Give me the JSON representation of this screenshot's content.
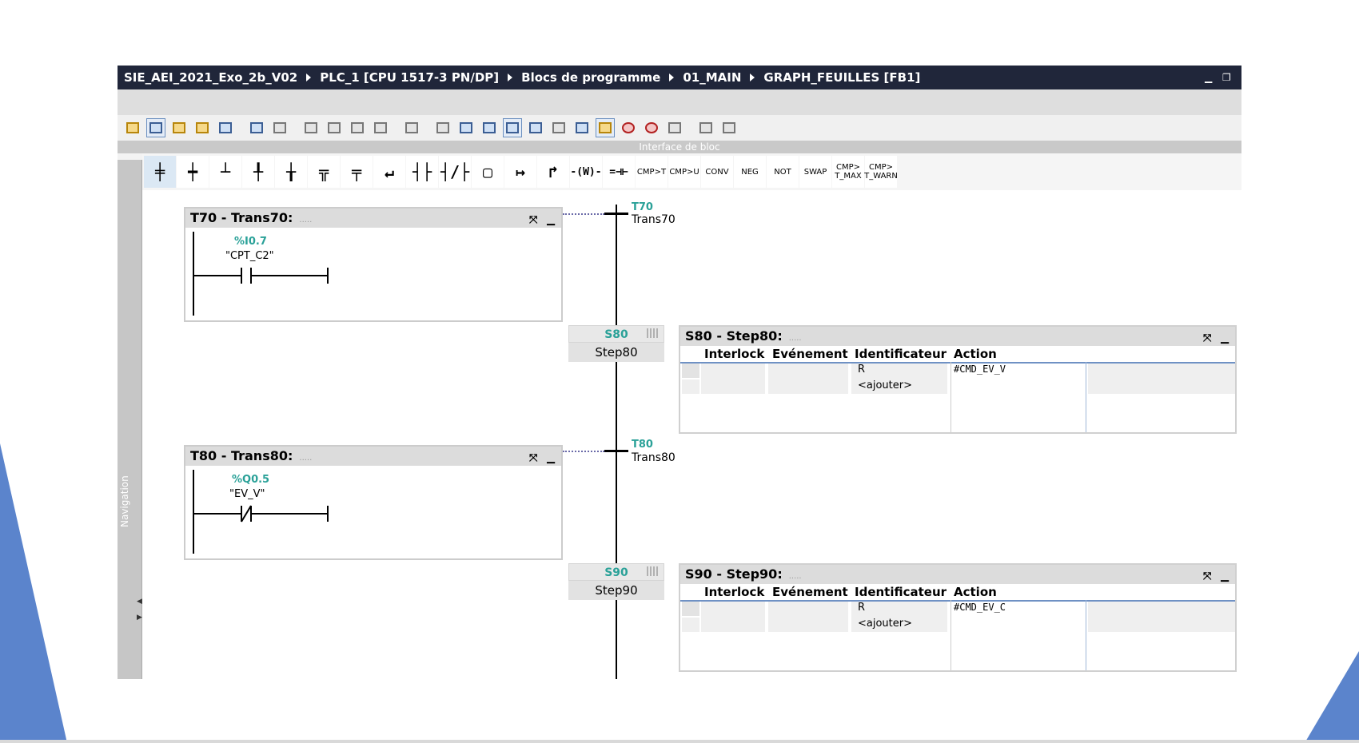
{
  "breadcrumb": [
    "SIE_AEI_2021_Exo_2b_V02",
    "PLC_1 [CPU 1517-3 PN/DP]",
    "Blocs de programme",
    "01_MAIN",
    "GRAPH_FEUILLES [FB1]"
  ],
  "interface_bar": "Interface de bloc",
  "navigation_label": "Navigation",
  "ladder_toolbar": [
    "CMP>T",
    "CMP>U",
    "CONV",
    "NEG",
    "NOT",
    "SWAP",
    "CMP> T_MAX",
    "CMP> T_WARN"
  ],
  "transitions": [
    {
      "header": "T70 - Trans70:",
      "address": "%I0.7",
      "symbol": "\"CPT_C2\"",
      "contact": "normally-open",
      "id": "T70",
      "name": "Trans70"
    },
    {
      "header": "T80 - Trans80:",
      "address": "%Q0.5",
      "symbol": "\"EV_V\"",
      "contact": "normally-closed",
      "id": "T80",
      "name": "Trans80"
    }
  ],
  "steps": [
    {
      "id": "S80",
      "name": "Step80",
      "header": "S80 - Step80:",
      "qualifier": "R",
      "add": "<ajouter>",
      "action": "#CMD_EV_V"
    },
    {
      "id": "S90",
      "name": "Step90",
      "header": "S90 - Step90:",
      "qualifier": "R",
      "add": "<ajouter>",
      "action": "#CMD_EV_C"
    }
  ],
  "action_columns": [
    "Interlock",
    "Evénement",
    "Identificateur",
    "Action"
  ],
  "colors": {
    "titlebar": "#20263a",
    "address": "#2aa198",
    "slide_accent": "#4f79c4"
  }
}
